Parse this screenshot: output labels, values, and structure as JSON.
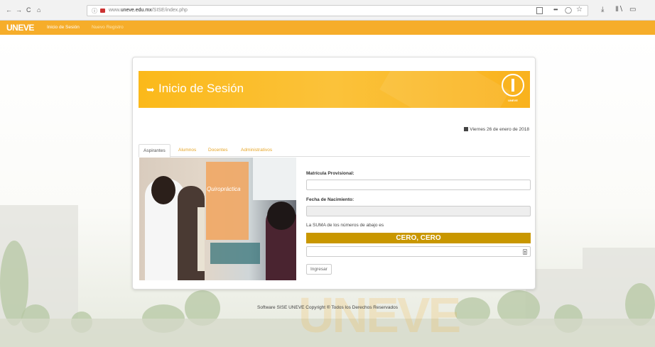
{
  "browser": {
    "back": "←",
    "forward": "→",
    "reload": "C",
    "home": "⌂",
    "url_prefix": "www.",
    "url_domain": "uneve.edu.mx",
    "url_path": "/SISE/index.php",
    "more": "•••",
    "download": "⤓",
    "library": "Ⅱ∖",
    "sidebar": "▭"
  },
  "navbar": {
    "brand": "UNEVE",
    "items": [
      {
        "label": "Inicio de Sesión",
        "active": true
      },
      {
        "label": "Nuevo Registro",
        "active": false
      }
    ]
  },
  "banner": {
    "title": "Inicio de Sesión",
    "icon": "login-icon",
    "seal_text": "UNEVE"
  },
  "date": "Viernes 26 de enero de 2018",
  "tabs": [
    "Aspirantes",
    "Alumnos",
    "Docentes",
    "Administrativos"
  ],
  "photo": {
    "poster_text": "Quiropráctica"
  },
  "form": {
    "matricula_label": "Matrícula Provisional:",
    "nacimiento_label": "Fecha de Nacimiento:",
    "sum_text": "La SUMA de los números de abajo es",
    "captcha": "CERO, CERO",
    "submit": "Ingresar"
  },
  "footer": "Software SISE UNEVE Copyright ® Todos los Derechos Reservados",
  "watermark": "UNEVE",
  "colors": {
    "accent": "#f6ad2a",
    "captcha": "#c99700",
    "tab_link": "#e6a526"
  }
}
